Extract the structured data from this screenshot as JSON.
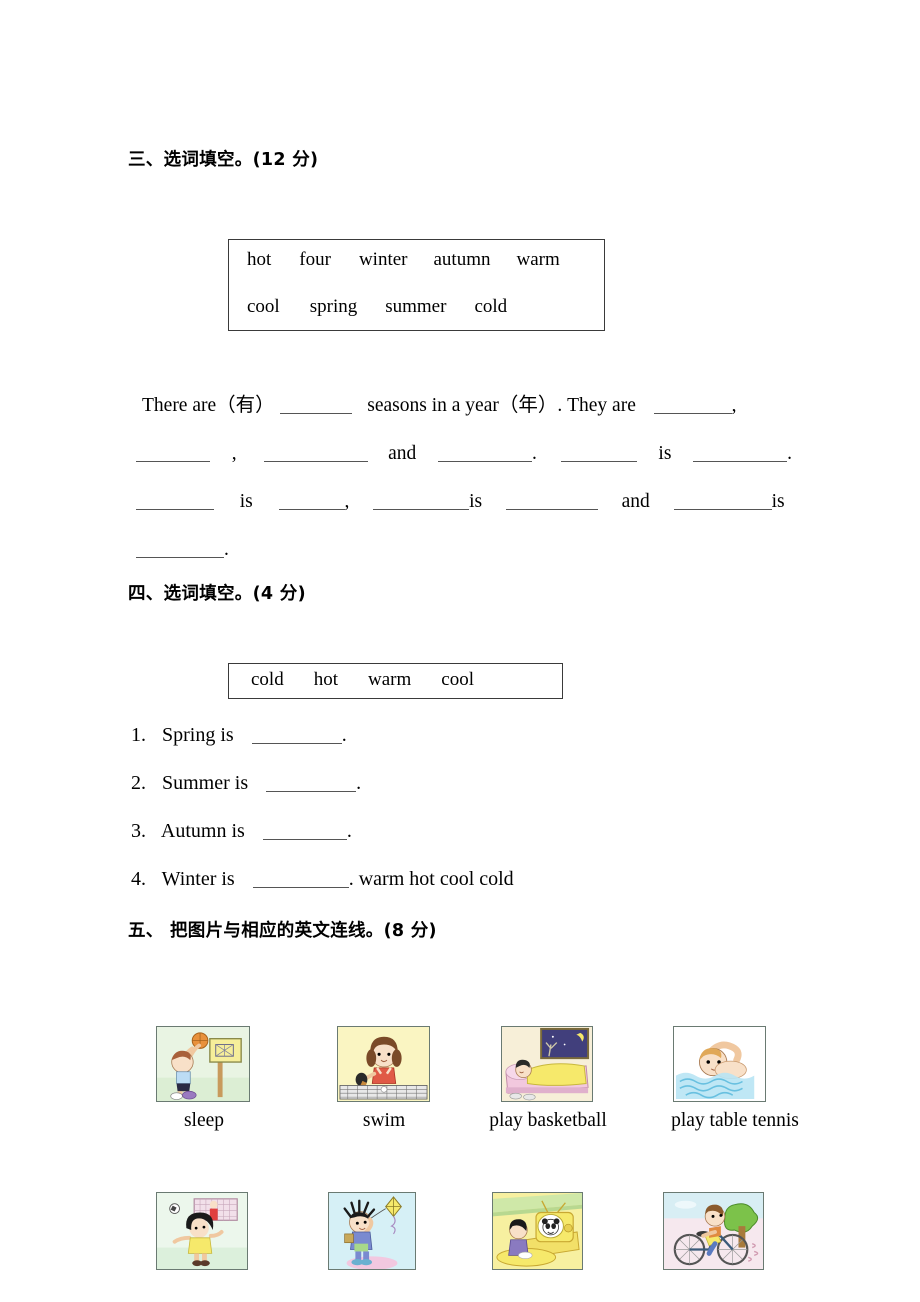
{
  "sections": {
    "three": {
      "heading": "三、选词填空。(12 分)",
      "word_bank": {
        "row1": [
          "hot",
          "four",
          "winter",
          "autumn",
          "warm"
        ],
        "row2": [
          "cool",
          "spring",
          "summer",
          "cold"
        ]
      },
      "cloze": {
        "line1_a": "There are（有）",
        "line1_b": "seasons in a year（年）. They are",
        "line1_c": ",",
        "line2_a": ",",
        "line2_b": "and",
        "line2_c": ".",
        "line2_d": "is",
        "line2_e": ".",
        "line3_a": "is",
        "line3_b": ",",
        "line3_c": "is",
        "line3_d": "and",
        "line3_e": "is",
        "line4_a": "."
      }
    },
    "four": {
      "heading": "四、选词填空。(4 分)",
      "word_bank": [
        "cold",
        "hot",
        "warm",
        "cool"
      ],
      "questions": [
        {
          "number": "1.",
          "text": "Spring is",
          "tail": "."
        },
        {
          "number": "2.",
          "text": "Summer is",
          "tail": "."
        },
        {
          "number": "3.",
          "text": "Autumn is",
          "tail": "."
        },
        {
          "number": "4.",
          "text": "Winter is",
          "tail": ". warm hot cool cold"
        }
      ]
    },
    "five": {
      "heading": "五、 把图片与相应的英文连线。(8 分)",
      "row1_captions": [
        "sleep",
        "swim",
        "play basketball",
        "play table tennis"
      ],
      "pictures_row1": [
        {
          "name": "picture-boy-playing-basketball",
          "alt": "boy shooting a basketball at a hoop"
        },
        {
          "name": "picture-girl-playing-table-tennis",
          "alt": "girl at a table tennis table"
        },
        {
          "name": "picture-child-sleeping-in-bed",
          "alt": "child asleep in bed at night"
        },
        {
          "name": "picture-child-swimming",
          "alt": "child swimming in water"
        }
      ],
      "pictures_row2": [
        {
          "name": "picture-boy-playing-football",
          "alt": "boy kicking a football at a goal"
        },
        {
          "name": "picture-boy-flying-a-kite",
          "alt": "boy flying a kite"
        },
        {
          "name": "picture-child-watching-tv",
          "alt": "child watching television"
        },
        {
          "name": "picture-boy-riding-a-bike",
          "alt": "boy riding a bicycle"
        }
      ]
    }
  },
  "colors": {
    "ink": "#000000",
    "rule": "#555555",
    "box_border": "#3a3a3a",
    "pic_border": "#6a7a72",
    "basketball_bg": "#e8f4e4",
    "tabletennis_bg": "#faf5c8",
    "sleep_bg": "#f6eeda",
    "swim_bg": "#ffffff",
    "football_bg": "#eaf6ea",
    "kite_bg": "#d8f0f4",
    "tv_bg": "#f6ef9e",
    "bike_bg": "#f6e8ee",
    "skin": "#f8e0c8",
    "orange_ball": "#e8913c",
    "yellow": "#f6e96b",
    "night_blue": "#413f7c",
    "water_blue": "#a8dcf0",
    "red_top": "#e05a46",
    "hair_brown": "#8a5a36",
    "hair_black": "#1a1a1a",
    "purple": "#8a7ec0",
    "green_tree": "#7cc24a",
    "pink": "#f2c3d8"
  }
}
